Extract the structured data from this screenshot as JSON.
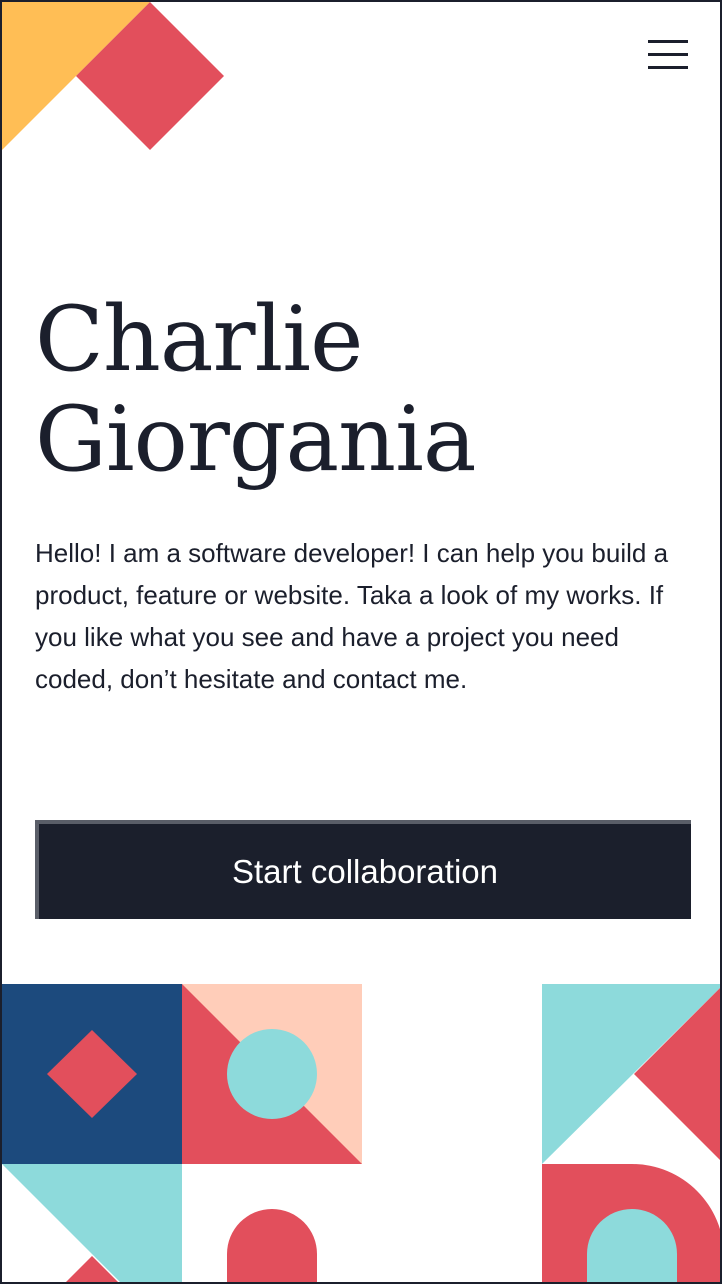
{
  "header": {
    "menu_icon": "hamburger-menu-icon"
  },
  "hero": {
    "name_first": "Charlie",
    "name_last": "Giorgania",
    "intro": "Hello! I am a software developer! I can help you build a product, feature or website. Taka a look of my works. If you like what you see and have a project you need coded, don’t hesitate and contact me."
  },
  "cta": {
    "label": "Start collaboration"
  },
  "colors": {
    "navy": "#1b1f2c",
    "coral": "#e24f5c",
    "yellow": "#ffbe55",
    "teal": "#8ddadb",
    "peach": "#ffcdb9",
    "blue": "#1c4a7d"
  }
}
